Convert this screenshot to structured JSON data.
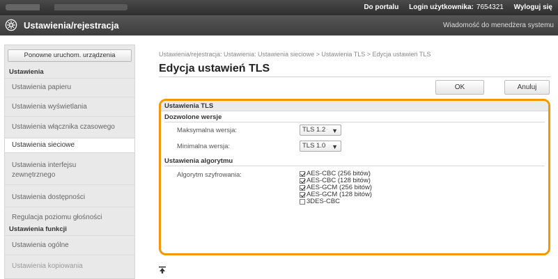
{
  "topbar": {
    "portal_link": "Do portalu",
    "login_label": "Login użytkownika:",
    "login_value": "7654321",
    "logout_link": "Wyloguj się"
  },
  "titlebar": {
    "title": "Ustawienia/rejestracja",
    "manager_message": "Wiadomość do menedżera systemu",
    "icon": "gear-icon"
  },
  "sidebar": {
    "restart_button": "Ponowne uruchom. urządzenia",
    "settings_header": "Ustawienia",
    "items": [
      {
        "label": "Ustawienia papieru"
      },
      {
        "label": "Ustawienia wyświetlania"
      },
      {
        "label": "Ustawienia włącznika czasowego"
      },
      {
        "label": "Ustawienia sieciowe"
      },
      {
        "label": "Ustawienia interfejsu"
      },
      {
        "label": "zewnętrznego"
      },
      {
        "label": "Ustawienia dostępności"
      },
      {
        "label": "Regulacja poziomu głośności"
      }
    ],
    "functions_header": "Ustawienia funkcji",
    "func_items": [
      {
        "label": "Ustawienia ogólne"
      },
      {
        "label": "Ustawienia kopiowania"
      }
    ],
    "active_item": "Ustawienia sieciowe"
  },
  "main": {
    "breadcrumb": "Ustawienia/rejestracja: Ustawienia: Ustawienia sieciowe > Ustawienia TLS > Edycja ustawień TLS",
    "heading": "Edycja ustawień TLS",
    "ok_button": "OK",
    "cancel_button": "Anuluj",
    "panel": {
      "title": "Ustawienia TLS",
      "allowed_versions_header": "Dozwolone wersje",
      "max_version_label": "Maksymalna wersja:",
      "max_version_value": "TLS 1.2",
      "min_version_label": "Minimalna wersja:",
      "min_version_value": "TLS 1.0",
      "algorithm_header": "Ustawienia algorytmu",
      "encryption_label": "Algorytm szyfrowania:",
      "algorithms": [
        {
          "label": "AES-CBC (256 bitów)",
          "checked": true
        },
        {
          "label": "AES-CBC (128 bitów)",
          "checked": true
        },
        {
          "label": "AES-GCM (256 bitów)",
          "checked": true
        },
        {
          "label": "AES-GCM (128 bitów)",
          "checked": true
        },
        {
          "label": "3DES-CBC",
          "checked": false
        }
      ]
    },
    "to_top_icon": "to-top-icon"
  },
  "colors": {
    "accent": "#f39800",
    "header_dark": "#3c3c3c"
  }
}
